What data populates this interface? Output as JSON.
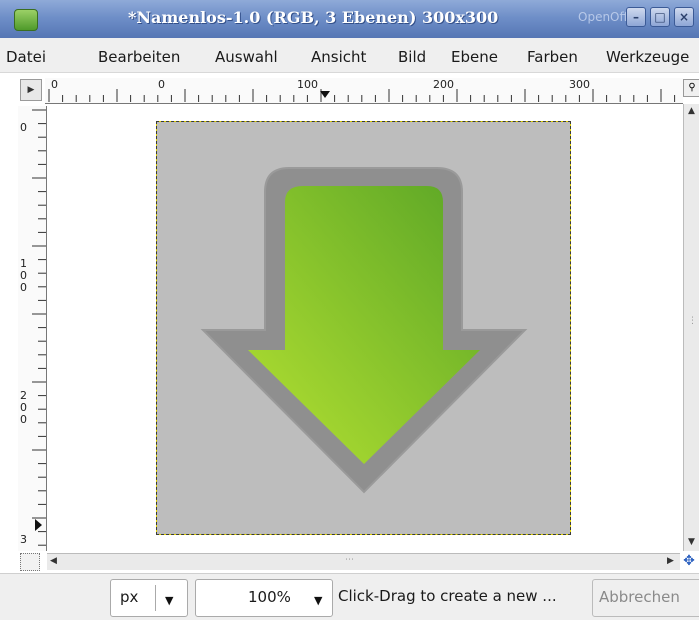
{
  "window": {
    "title": "*Namenlos-1.0 (RGB, 3 Ebenen) 300x300",
    "watermark_text": "OpenOffice",
    "buttons": {
      "minimize": "–",
      "maximize": "□",
      "close": "×"
    }
  },
  "menu": {
    "items": [
      {
        "label": "Datei"
      },
      {
        "label": "Bearbeiten"
      },
      {
        "label": "Auswahl"
      },
      {
        "label": "Ansicht"
      },
      {
        "label": "Bild"
      },
      {
        "label": "Ebene"
      },
      {
        "label": "Farben"
      },
      {
        "label": "Werkzeuge"
      }
    ]
  },
  "rulers": {
    "horizontal_labels": [
      "0",
      "0",
      "100",
      "200",
      "300"
    ],
    "vertical_labels": [
      "0",
      "1",
      "0",
      "0",
      "2",
      "0",
      "0",
      "3"
    ]
  },
  "canvas": {
    "background_color": "#bdbdbd",
    "arrow_outer_color": "#8f8f8f",
    "arrow_gradient": [
      "#b6e232",
      "#5aa526"
    ],
    "selection_color": "#e2d300"
  },
  "statusbar": {
    "unit": "px",
    "zoom": "100%",
    "message": "Click-Drag to create a new ...",
    "cancel": "Abbrechen"
  },
  "icons": {
    "nav": "navigate-icon",
    "zoom": "zoom-icon",
    "move": "move-icon",
    "quickmask": "quickmask-icon",
    "app": "gimp-icon"
  }
}
